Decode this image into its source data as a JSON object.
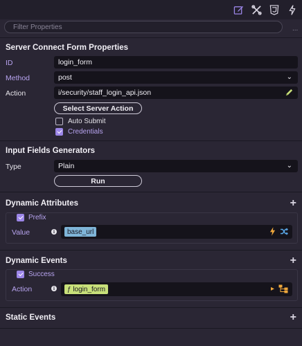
{
  "toolbar": {
    "icons": [
      "edit-icon",
      "tools-icon",
      "css3-icon",
      "bolt-icon"
    ],
    "accent": "#9c86e8"
  },
  "filter": {
    "placeholder": "Filter Properties",
    "more": "..."
  },
  "form_props": {
    "title": "Server Connect Form Properties",
    "id_label": "ID",
    "id_value": "login_form",
    "method_label": "Method",
    "method_value": "post",
    "action_label": "Action",
    "action_value": "i/security/staff_login_api.json",
    "select_action_button": "Select Server Action",
    "auto_submit_label": "Auto Submit",
    "auto_submit_checked": false,
    "credentials_label": "Credentials",
    "credentials_checked": true
  },
  "generators": {
    "title": "Input Fields Generators",
    "type_label": "Type",
    "type_value": "Plain",
    "run_button": "Run"
  },
  "dynamic_attributes": {
    "title": "Dynamic Attributes",
    "prefix_label": "Prefix",
    "prefix_checked": true,
    "value_label": "Value",
    "value_chip": "base_url"
  },
  "dynamic_events": {
    "title": "Dynamic Events",
    "success_label": "Success",
    "success_checked": true,
    "action_label": "Action",
    "action_chip": "ƒ login_form"
  },
  "static_events": {
    "title": "Static Events"
  }
}
